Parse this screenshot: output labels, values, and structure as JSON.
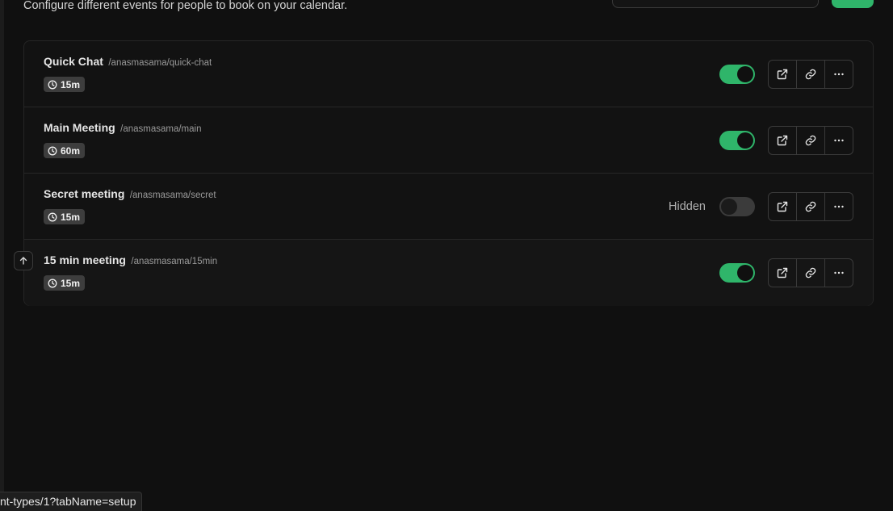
{
  "header": {
    "subtitle": "Configure different events for people to book on your calendar."
  },
  "events": [
    {
      "title": "Quick Chat",
      "slug": "/anasmasama/quick-chat",
      "duration": "15m",
      "enabled": true,
      "hidden_label": ""
    },
    {
      "title": "Main Meeting",
      "slug": "/anasmasama/main",
      "duration": "60m",
      "enabled": true,
      "hidden_label": ""
    },
    {
      "title": "Secret meeting",
      "slug": "/anasmasama/secret",
      "duration": "15m",
      "enabled": false,
      "hidden_label": "Hidden"
    },
    {
      "title": "15 min meeting",
      "slug": "/anasmasama/15min",
      "duration": "15m",
      "enabled": true,
      "hidden_label": ""
    }
  ],
  "icons": {
    "duration": "clock-icon",
    "preview": "external-link-icon",
    "copy": "link-icon",
    "more": "more-horizontal-icon",
    "move_up": "arrow-up-icon"
  },
  "colors": {
    "accent": "#2fb56a",
    "background": "#101010"
  },
  "status_bar": {
    "url": "nt-types/1?tabName=setup"
  }
}
